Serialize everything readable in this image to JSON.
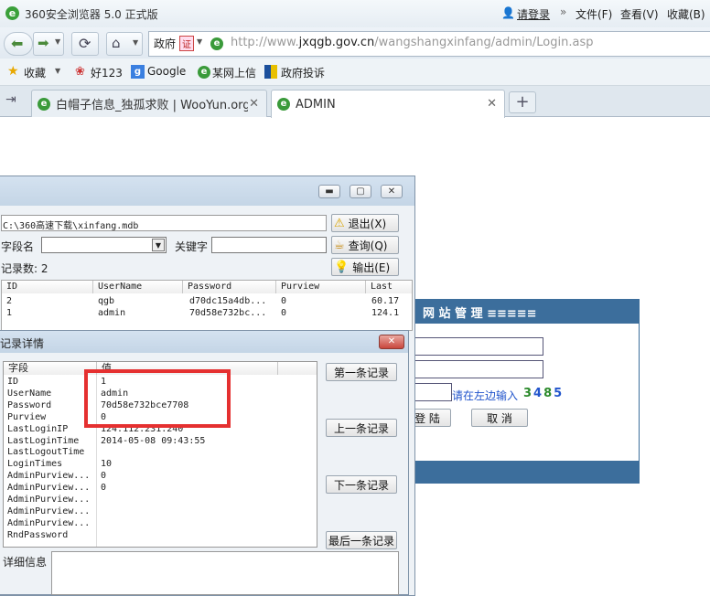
{
  "browser": {
    "title": "360安全浏览器 5.0 正式版",
    "login_label": "请登录",
    "menu": [
      "文件(F)",
      "查看(V)",
      "收藏(B)"
    ],
    "gov_label": "政府",
    "gov_badge": "证",
    "url_prefix": "http://www.",
    "url_domain": "jxqgb.gov.cn",
    "url_path": "/wangshangxinfang/admin/Login.asp",
    "favorites": [
      "收藏",
      "好123",
      "Google",
      "某网上信",
      "政府投诉"
    ],
    "tabs": [
      {
        "label": "白帽子信息_独孤求败 | WooYun.org"
      },
      {
        "label": "ADMIN"
      }
    ]
  },
  "login_page": {
    "header_text": "网 站 管 理 ≡≡≡≡≡",
    "captcha_hint": "请在左边输入",
    "captcha_digits": [
      "3",
      "4",
      "8",
      "5"
    ],
    "captcha_colors": [
      "#2b8a2b",
      "#2255cc",
      "#2b8a2b",
      "#2255cc"
    ],
    "login_button": "登 陆",
    "cancel_button": "取 消"
  },
  "db_tool": {
    "path": "C:\\360高速下载\\xinfang.mdb",
    "field_label": "字段名",
    "keyword_label": "关键字",
    "record_count": "记录数: 2",
    "buttons": {
      "exit": "退出(X)",
      "query": "查询(Q)",
      "export": "输出(E)"
    },
    "columns": [
      "ID",
      "UserName",
      "Password",
      "Purview",
      "Last"
    ],
    "rows": [
      [
        "2",
        "qgb",
        "d70dc15a4db...",
        "0",
        "60.17"
      ],
      [
        "1",
        "admin",
        "70d58e732bc...",
        "0",
        "124.1"
      ]
    ]
  },
  "detail": {
    "title": "记录详情",
    "col_field": "字段",
    "col_value": "值",
    "fields": [
      {
        "k": "ID",
        "v": "1"
      },
      {
        "k": "UserName",
        "v": "admin"
      },
      {
        "k": "Password",
        "v": "70d58e732bce7708"
      },
      {
        "k": "Purview",
        "v": "0"
      },
      {
        "k": "LastLoginIP",
        "v": "124.112.231.240"
      },
      {
        "k": "LastLoginTime",
        "v": "2014-05-08 09:43:55"
      },
      {
        "k": "LastLogoutTime",
        "v": ""
      },
      {
        "k": "LoginTimes",
        "v": "10"
      },
      {
        "k": "AdminPurview...",
        "v": "0"
      },
      {
        "k": "AdminPurview...",
        "v": "0"
      },
      {
        "k": "AdminPurview...",
        "v": ""
      },
      {
        "k": "AdminPurview...",
        "v": ""
      },
      {
        "k": "AdminPurview...",
        "v": ""
      },
      {
        "k": "RndPassword",
        "v": ""
      }
    ],
    "buttons": {
      "first": "第一条记录",
      "prev": "上一条记录",
      "next": "下一条记录",
      "last": "最后一条记录"
    },
    "detail_info_label": "详细信息"
  },
  "colors": {
    "accent_blue": "#3c6e9c",
    "highlight_red": "#e53030"
  }
}
